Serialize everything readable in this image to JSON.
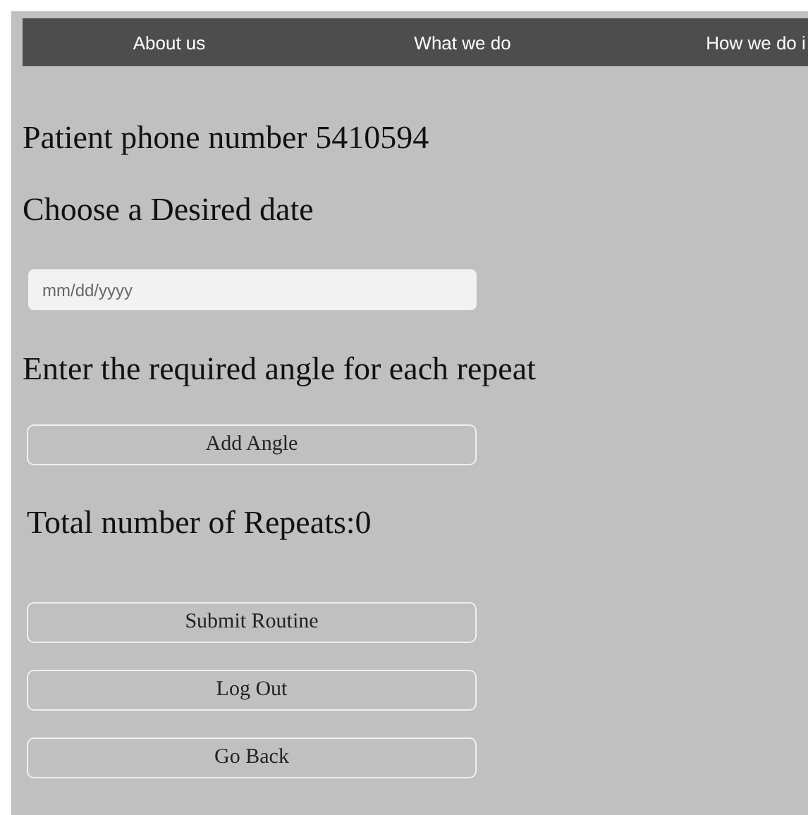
{
  "nav": [
    {
      "label": "About us"
    },
    {
      "label": "What we do"
    },
    {
      "label": "How we do i"
    }
  ],
  "patient_phone": "Patient phone number 5410594",
  "date_heading": "Choose a Desired date",
  "date_field": {
    "placeholder": "mm/dd/yyyy"
  },
  "angle_heading": "Enter the required angle for each repeat",
  "add_angle_button": "Add Angle",
  "total_repeats": "Total number of Repeats:0",
  "buttons": [
    "Submit Routine",
    "Log Out",
    "Go Back"
  ]
}
